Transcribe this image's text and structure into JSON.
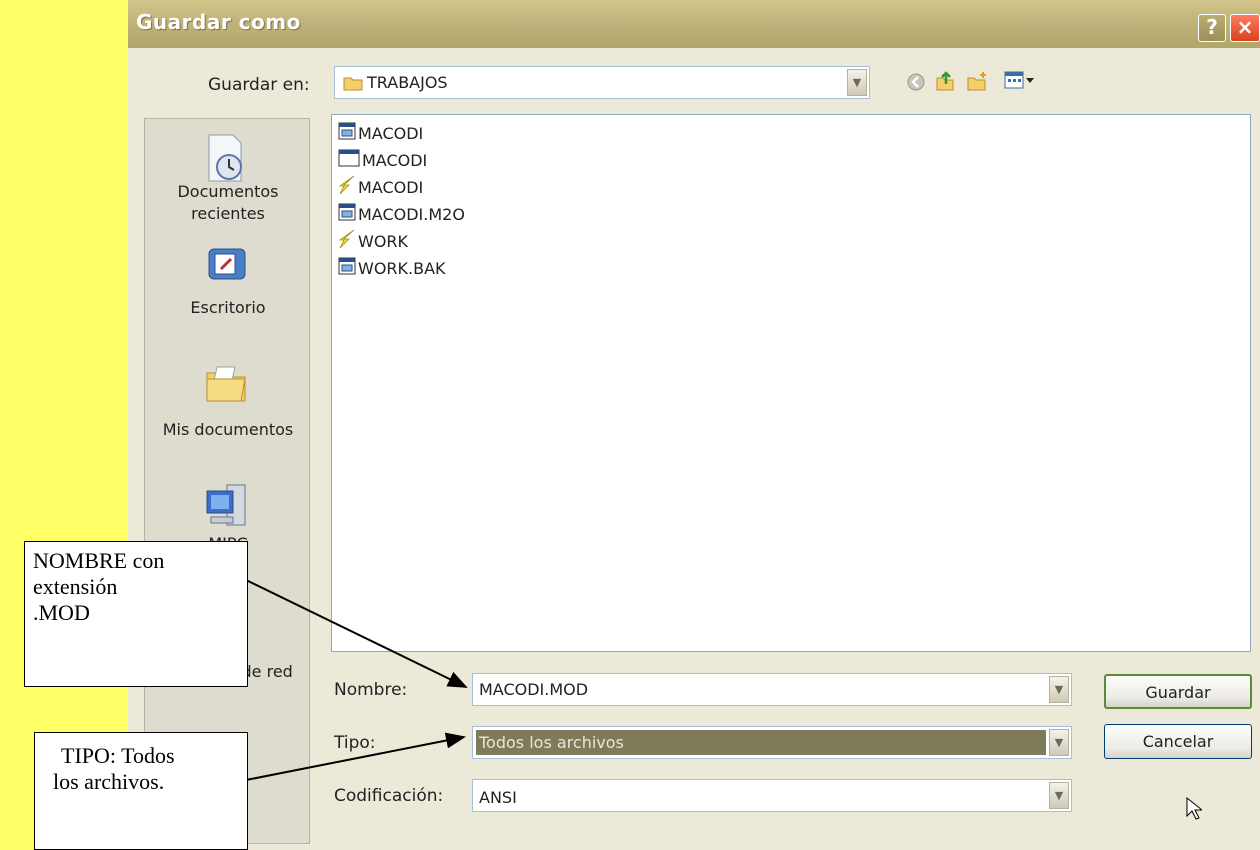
{
  "dialog": {
    "title": "Guardar como",
    "help_glyph": "?",
    "close_glyph": "×"
  },
  "save_in": {
    "label": "Guardar en:",
    "value": "TRABAJOS",
    "folder_icon": "folder-icon"
  },
  "toolbar": {
    "icons": [
      "back-icon",
      "up-folder-icon",
      "new-folder-icon",
      "view-menu-icon"
    ]
  },
  "places": [
    {
      "label_line1": "Documentos",
      "label_line2": "recientes",
      "icon": "recent-documents-icon"
    },
    {
      "label_line1": "Escritorio",
      "label_line2": "",
      "icon": "desktop-icon"
    },
    {
      "label_line1": "Mis documentos",
      "label_line2": "",
      "icon": "my-documents-icon"
    },
    {
      "label_line1": "MIPC",
      "label_line2": "",
      "icon": "my-computer-icon"
    },
    {
      "label_line1": "Mis sitios de red",
      "label_line2": "",
      "icon": "network-places-icon"
    }
  ],
  "files": [
    {
      "name": "MACODI",
      "icon": "document-icon"
    },
    {
      "name": "MACODI",
      "icon": "window-icon"
    },
    {
      "name": "MACODI",
      "icon": "lightning-icon"
    },
    {
      "name": "MACODI.M2O",
      "icon": "document-icon"
    },
    {
      "name": "WORK",
      "icon": "lightning-icon"
    },
    {
      "name": "WORK.BAK",
      "icon": "document-icon"
    }
  ],
  "form": {
    "name_label": "Nombre:",
    "name_value": "MACODI.MOD",
    "type_label": "Tipo:",
    "type_value": "Todos los archivos",
    "encoding_label": "Codificación:",
    "encoding_value": "ANSI"
  },
  "buttons": {
    "save": "Guardar",
    "cancel": "Cancelar"
  },
  "callouts": {
    "name_line1": "NOMBRE con",
    "name_line2": "extensión",
    "name_line3": ".MOD",
    "type_line1": "TIPO: Todos",
    "type_line2": "los archivos."
  },
  "colors": {
    "background": "#ffff66",
    "dialog": "#ece9d8",
    "titlebar": "#c2b57d",
    "selected_type": "#7f7a5a"
  }
}
